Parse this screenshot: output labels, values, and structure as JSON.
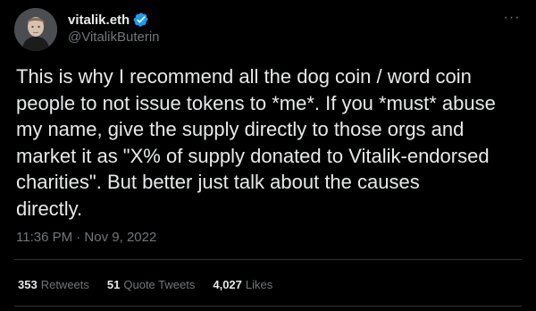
{
  "author": {
    "display_name": "vitalik.eth",
    "handle": "@VitalikButerin",
    "verified_icon": "verified-badge-icon",
    "avatar_icon": "avatar-image"
  },
  "tweet": {
    "text": "This is why I recommend all the dog coin / word coin\npeople to not issue tokens to *me*. If you *must* abuse\nmy name, give the supply directly to those orgs and\nmarket it as \"X% of supply donated to Vitalik-endorsed\ncharities\". But better just talk about the causes\ndirectly.",
    "timestamp": "11:36 PM · Nov 9, 2022"
  },
  "stats": {
    "retweets_count": "353",
    "retweets_label": "Retweets",
    "quote_tweets_count": "51",
    "quote_tweets_label": "Quote Tweets",
    "likes_count": "4,027",
    "likes_label": "Likes"
  },
  "more_menu": {
    "icon": "more-options-icon",
    "glyph": "···"
  },
  "colors": {
    "background": "#000000",
    "text_primary": "#e7e9ea",
    "text_secondary": "#71767b",
    "divider": "#2f3336",
    "verified_blue": "#1d9bf0"
  }
}
